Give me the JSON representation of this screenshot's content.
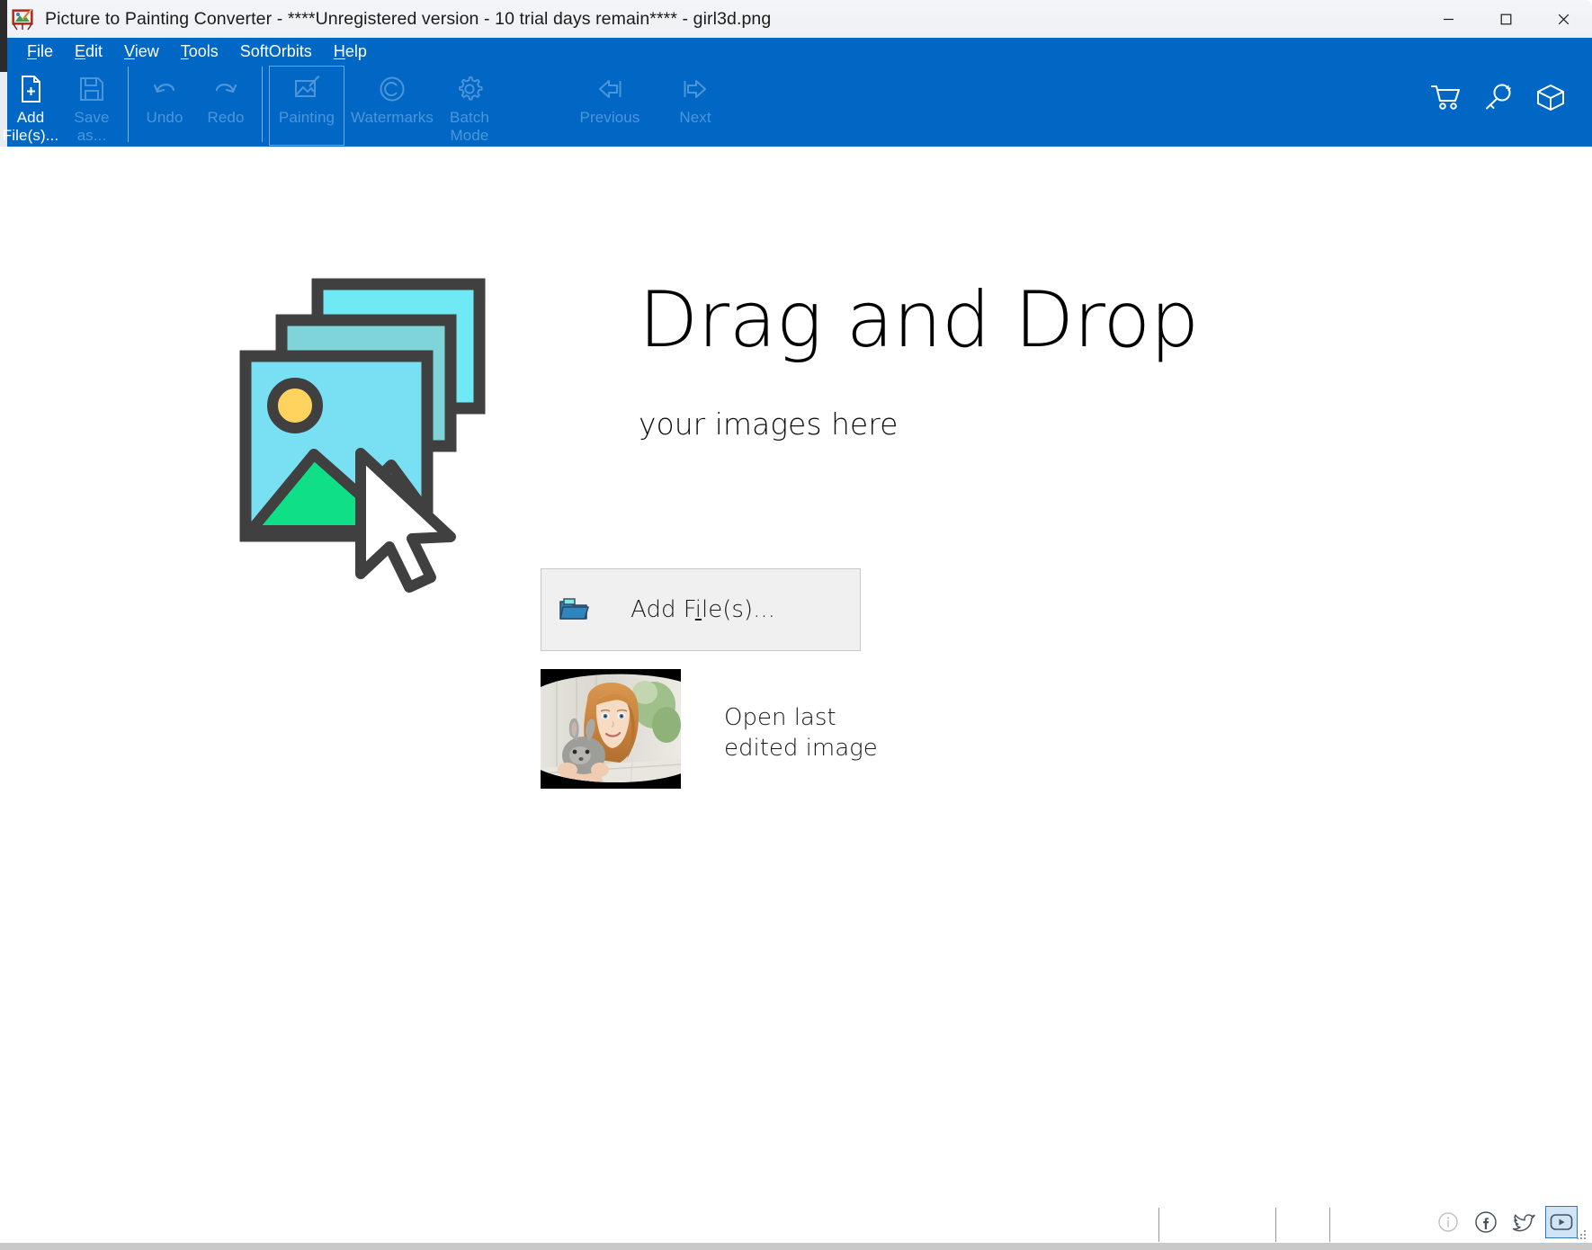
{
  "window": {
    "title": "Picture to Painting Converter - ****Unregistered version - 10 trial days remain**** - girl3d.png",
    "app_icon": "easel-palette-icon",
    "minimize_label": "Minimize",
    "maximize_label": "Maximize",
    "close_label": "Close"
  },
  "menubar": {
    "items": [
      {
        "label": "File",
        "accel": "F"
      },
      {
        "label": "Edit",
        "accel": "E"
      },
      {
        "label": "View",
        "accel": "V"
      },
      {
        "label": "Tools",
        "accel": "T"
      },
      {
        "label": "SoftOrbits",
        "accel": ""
      },
      {
        "label": "Help",
        "accel": "H"
      }
    ]
  },
  "toolbar": {
    "buttons": [
      {
        "label": "Add\nFile(s)...",
        "icon": "add-file-icon",
        "enabled": true,
        "focused": false
      },
      {
        "label": "Save\nas...",
        "icon": "save-icon",
        "enabled": false,
        "focused": false
      },
      {
        "label": "Undo",
        "icon": "undo-icon",
        "enabled": false,
        "focused": false
      },
      {
        "label": "Redo",
        "icon": "redo-icon",
        "enabled": false,
        "focused": false
      },
      {
        "label": "Painting",
        "icon": "painting-icon",
        "enabled": false,
        "focused": true
      },
      {
        "label": "Watermarks",
        "icon": "copyright-icon",
        "enabled": false,
        "focused": false
      },
      {
        "label": "Batch\nMode",
        "icon": "gear-icon",
        "enabled": false,
        "focused": false
      },
      {
        "label": "Previous",
        "icon": "arrow-left-icon",
        "enabled": false,
        "focused": false
      },
      {
        "label": "Next",
        "icon": "arrow-right-icon",
        "enabled": false,
        "focused": false
      }
    ],
    "right_icons": [
      {
        "name": "shopping-cart-icon",
        "title": "Buy"
      },
      {
        "name": "key-icon",
        "title": "Register"
      },
      {
        "name": "box-icon",
        "title": "Products"
      }
    ]
  },
  "main": {
    "drop_title": "Drag and Drop",
    "drop_subtitle": "your images here",
    "drop_illustration": "images-with-cursor-icon",
    "add_files_button": {
      "text_before": "Add F",
      "accel": "i",
      "text_after": "le(s)...",
      "icon": "open-folder-icon"
    },
    "open_last_edited": {
      "label": "Open last edited image",
      "thumbnail": "girl-with-rabbit-thumbnail"
    }
  },
  "statusbar": {
    "icons": [
      {
        "name": "info-icon",
        "selected": false,
        "dimmed": true
      },
      {
        "name": "facebook-icon",
        "selected": false,
        "dimmed": false
      },
      {
        "name": "twitter-icon",
        "selected": false,
        "dimmed": false
      },
      {
        "name": "youtube-icon",
        "selected": true,
        "dimmed": false
      }
    ]
  },
  "colors": {
    "ribbon": "#0067c5",
    "accent_selection": "#2b78bd",
    "button_face": "#f0f0f0",
    "art_outline": "#404040",
    "art_sky": "#6fe0f0",
    "art_green": "#0fdf87",
    "art_sun": "#ffd45e"
  }
}
